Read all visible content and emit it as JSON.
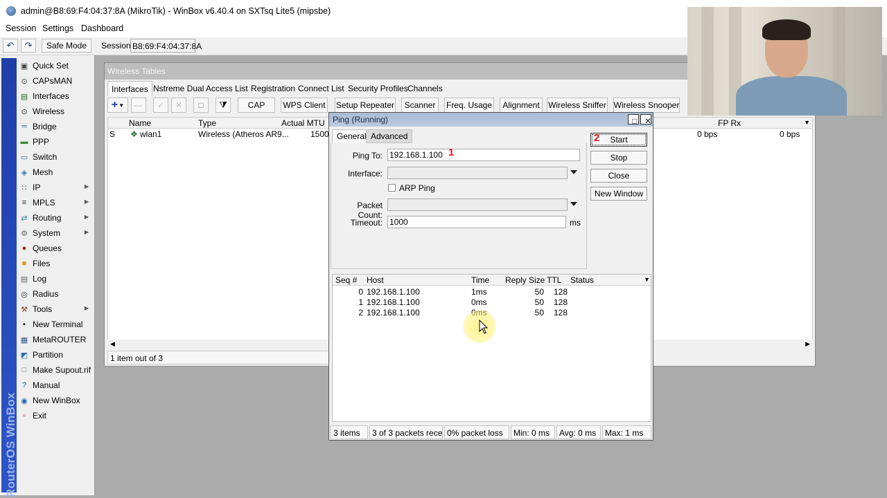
{
  "window": {
    "title": "admin@B8:69:F4:04:37:8A (MikroTik) - WinBox v6.40.4 on SXTsq Lite5 (mipsbe)"
  },
  "menu": [
    "Session",
    "Settings",
    "Dashboard"
  ],
  "toolbar": {
    "safe_mode": "Safe Mode",
    "session_label": "Session:",
    "session_value": "B8:69:F4:04:37:8A"
  },
  "sidebar": {
    "brand": "RouterOS WinBox",
    "items": [
      {
        "label": "Quick Set",
        "icon": "quick-set-icon"
      },
      {
        "label": "CAPsMAN",
        "icon": "capsman-icon"
      },
      {
        "label": "Interfaces",
        "icon": "interfaces-icon"
      },
      {
        "label": "Wireless",
        "icon": "wireless-icon"
      },
      {
        "label": "Bridge",
        "icon": "bridge-icon"
      },
      {
        "label": "PPP",
        "icon": "ppp-icon"
      },
      {
        "label": "Switch",
        "icon": "switch-icon"
      },
      {
        "label": "Mesh",
        "icon": "mesh-icon"
      },
      {
        "label": "IP",
        "icon": "ip-icon",
        "submenu": true
      },
      {
        "label": "MPLS",
        "icon": "mpls-icon",
        "submenu": true
      },
      {
        "label": "Routing",
        "icon": "routing-icon",
        "submenu": true
      },
      {
        "label": "System",
        "icon": "system-icon",
        "submenu": true
      },
      {
        "label": "Queues",
        "icon": "queues-icon"
      },
      {
        "label": "Files",
        "icon": "files-icon"
      },
      {
        "label": "Log",
        "icon": "log-icon"
      },
      {
        "label": "Radius",
        "icon": "radius-icon"
      },
      {
        "label": "Tools",
        "icon": "tools-icon",
        "submenu": true
      },
      {
        "label": "New Terminal",
        "icon": "terminal-icon"
      },
      {
        "label": "MetaROUTER",
        "icon": "metarouter-icon"
      },
      {
        "label": "Partition",
        "icon": "partition-icon"
      },
      {
        "label": "Make Supout.rif",
        "icon": "supout-icon"
      },
      {
        "label": "Manual",
        "icon": "manual-icon"
      },
      {
        "label": "New WinBox",
        "icon": "winbox-icon"
      },
      {
        "label": "Exit",
        "icon": "exit-icon"
      }
    ]
  },
  "wireless_tables": {
    "title": "Wireless Tables",
    "tabs": [
      "Interfaces",
      "Nstreme Dual",
      "Access List",
      "Registration",
      "Connect List",
      "Security Profiles",
      "Channels"
    ],
    "buttons": [
      "CAP",
      "WPS Client",
      "Setup Repeater",
      "Scanner",
      "Freq. Usage",
      "Alignment",
      "Wireless Sniffer",
      "Wireless Snooper"
    ],
    "columns": [
      "Name",
      "Type",
      "Actual MTU",
      "FP Rx"
    ],
    "row": {
      "flag": "S",
      "name": "wlan1",
      "type": "Wireless (Atheros AR9...",
      "mtu": "1500",
      "rate1": "0 bps",
      "rate2": "0 bps"
    },
    "status": "1 item out of 3"
  },
  "ping": {
    "title": "Ping (Running)",
    "tabs": [
      "General",
      "Advanced"
    ],
    "fields": {
      "ping_to_label": "Ping To:",
      "ping_to": "192.168.1.100",
      "interface_label": "Interface:",
      "arp_ping_label": "ARP Ping",
      "packet_count_label": "Packet Count:",
      "timeout_label": "Timeout:",
      "timeout": "1000",
      "timeout_unit": "ms"
    },
    "buttons": [
      "Start",
      "Stop",
      "Close",
      "New Window"
    ],
    "markers": {
      "one": "1",
      "two": "2"
    },
    "columns": [
      "Seq #",
      "Host",
      "Time",
      "Reply Size",
      "TTL",
      "Status"
    ],
    "rows": [
      {
        "seq": "0",
        "host": "192.168.1.100",
        "time": "1ms",
        "size": "50",
        "ttl": "128"
      },
      {
        "seq": "1",
        "host": "192.168.1.100",
        "time": "0ms",
        "size": "50",
        "ttl": "128"
      },
      {
        "seq": "2",
        "host": "192.168.1.100",
        "time": "0ms",
        "size": "50",
        "ttl": "128"
      }
    ],
    "status": [
      "3 items",
      "3 of 3 packets rece...",
      "0% packet loss",
      "Min: 0 ms",
      "Avg: 0 ms",
      "Max: 1 ms"
    ]
  }
}
